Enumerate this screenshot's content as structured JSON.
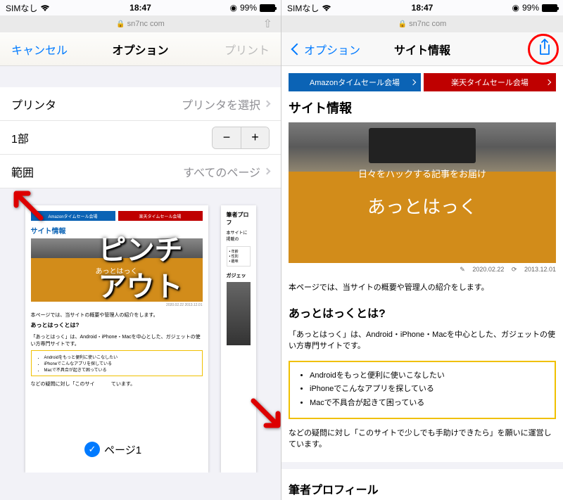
{
  "status": {
    "carrier": "SIMなし",
    "time": "18:47",
    "battery": "99%"
  },
  "url_bar": {
    "domain": "sn7nc com"
  },
  "left_panel": {
    "nav": {
      "cancel": "キャンセル",
      "title": "オプション",
      "action": "プリント"
    },
    "rows": {
      "printer_label": "プリンタ",
      "printer_value": "プリンタを選択",
      "copies_label": "1部",
      "range_label": "範囲",
      "range_value": "すべてのページ"
    },
    "page_indicator": "ページ1",
    "pinch_text_1": "ピンチ",
    "pinch_text_2": "アウト"
  },
  "right_panel": {
    "nav": {
      "back": "オプション",
      "title": "サイト情報"
    }
  },
  "site": {
    "amazon_btn": "Amazonタイムセール会場",
    "rakuten_btn": "楽天タイムセール会場",
    "title": "サイト情報",
    "hero_sub": "日々をハックする記事をお届け",
    "hero_main": "あっとはっく",
    "date_pub": "2020.02.22",
    "date_upd": "2013.12.01",
    "intro": "本ページでは、当サイトの概要や管理人の紹介をします。",
    "about_h": "あっとはっくとは?",
    "about_p": "「あっとはっく」は、Android・iPhone・Macを中心とした、ガジェットの使い方専門サイトです。",
    "list": {
      "i1": "Androidをもっと便利に使いこなしたい",
      "i2": "iPhoneでこんなアプリを探している",
      "i3": "Macで不具合が起きて困っている"
    },
    "outro": "などの疑問に対し「このサイトで少しでも手助けできたら」を願いに運営しています。",
    "author_h": "筆者プロフィール",
    "mini_outro_partial": "などの疑問に対し「このサイ",
    "mini_outro_suffix": "ています。",
    "mini_author_h": "筆者プロフ",
    "mini_author_p": "本サイトに掲載の"
  }
}
